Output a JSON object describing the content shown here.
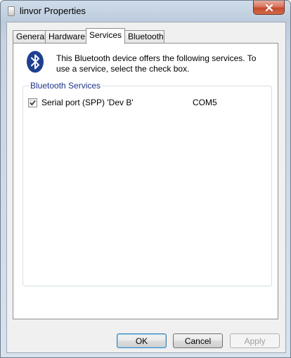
{
  "window": {
    "title": "linvor Properties"
  },
  "tabs": [
    {
      "label": "General",
      "active": false
    },
    {
      "label": "Hardware",
      "active": false
    },
    {
      "label": "Services",
      "active": true
    },
    {
      "label": "Bluetooth",
      "active": false
    }
  ],
  "services_page": {
    "icon": "bluetooth-icon",
    "intro_text": "This Bluetooth device offers the following services. To use a service, select the check box.",
    "group_label": "Bluetooth Services",
    "services": [
      {
        "name": "Serial port (SPP) 'Dev B'",
        "port": "COM5",
        "checked": true
      }
    ]
  },
  "buttons": {
    "ok": "OK",
    "cancel": "Cancel",
    "apply": "Apply"
  },
  "colors": {
    "bluetooth_icon_bg": "#1f3f8f",
    "close_button": "#c44a2d"
  }
}
